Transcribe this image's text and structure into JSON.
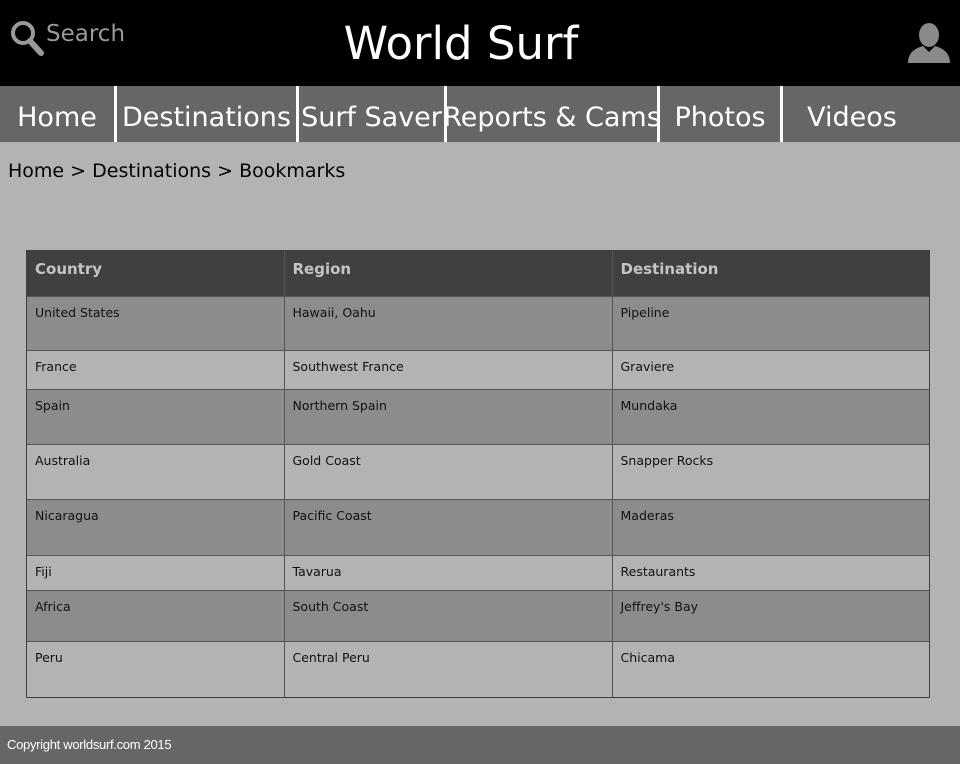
{
  "header": {
    "search_placeholder": "Search",
    "title": "World Surf",
    "icons": {
      "search": "search-icon",
      "user": "user-icon"
    }
  },
  "nav": {
    "items": [
      {
        "label": "Home"
      },
      {
        "label": "Destinations"
      },
      {
        "label": "Surf Saver"
      },
      {
        "label": "Reports & Cams"
      },
      {
        "label": "Photos"
      },
      {
        "label": "Videos"
      }
    ]
  },
  "breadcrumb": {
    "items": [
      "Home",
      "Destinations",
      "Bookmarks"
    ],
    "separator": ">"
  },
  "bookmarks_table": {
    "columns": [
      "Country",
      "Region",
      "Destination"
    ],
    "rows": [
      [
        "United States",
        "Hawaii, Oahu",
        "Pipeline"
      ],
      [
        "France",
        "Southwest France",
        "Graviere"
      ],
      [
        "Spain",
        "Northern Spain",
        "Mundaka"
      ],
      [
        "Australia",
        "Gold Coast",
        "Snapper Rocks"
      ],
      [
        "Nicaragua",
        "Pacific Coast",
        "Maderas"
      ],
      [
        "Fiji",
        "Tavarua",
        "Restaurants"
      ],
      [
        "Africa",
        "South Coast",
        "Jeffrey's Bay"
      ],
      [
        "Peru",
        "Central Peru",
        "Chicama"
      ]
    ]
  },
  "footer": {
    "copyright": "Copyright worldsurf.com 2015"
  },
  "colors": {
    "header_bg": "#000000",
    "nav_bg": "#666666",
    "page_bg": "#b3b3b3",
    "table_header_bg": "#404040",
    "row_dark": "#8c8c8c",
    "row_light": "#b3b3b3",
    "footer_bg": "#666666"
  }
}
